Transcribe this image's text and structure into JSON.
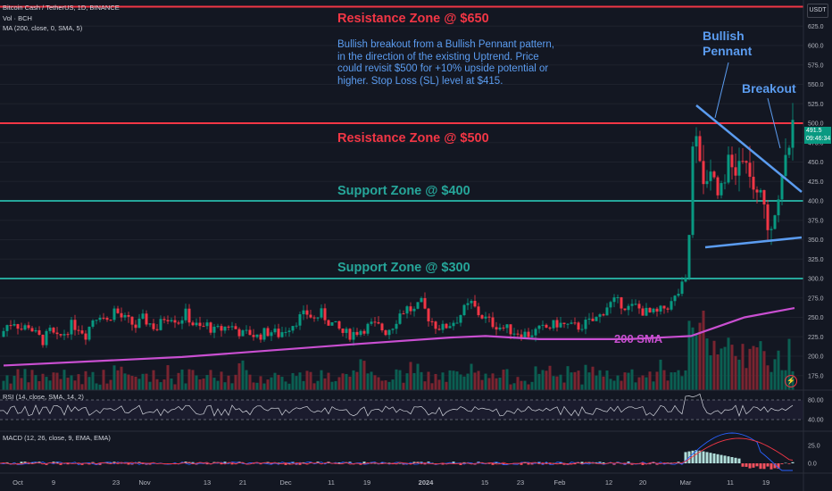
{
  "header": {
    "title": "Bitcoin Cash / TetherUS, 1D, BINANCE",
    "vol": "Vol · BCH",
    "ma": "MA (200, close, 0, SMA, 5)",
    "rsi": "RSI (14, close, SMA, 14, 2)",
    "macd": "MACD (12, 26, close, 9, EMA, EMA)"
  },
  "currency_button": "USDT",
  "last_price": {
    "value": "491.5",
    "countdown": "09:46:34"
  },
  "note": "Bullish breakout from a Bullish Pennant pattern, in the direction of the existing Uptrend. Price could revisit $500 for +10% upside potential or higher. Stop Loss (SL) level at $415.",
  "zones": [
    {
      "label": "Resistance Zone @ $650",
      "price": 650,
      "color": "#f23645"
    },
    {
      "label": "Resistance Zone @ $500",
      "price": 500,
      "color": "#f23645"
    },
    {
      "label": "Support Zone @ $400",
      "price": 400,
      "color": "#26a69a"
    },
    {
      "label": "Support Zone @ $300",
      "price": 300,
      "color": "#26a69a"
    }
  ],
  "annotations": {
    "pennant": "Bullish Pennant",
    "breakout": "Breakout",
    "sma": "200 SMA"
  },
  "colors": {
    "up": "#089981",
    "down": "#f23645",
    "sma": "#c94fd1",
    "pattern": "#5b9cf0",
    "bg": "#131722"
  },
  "chart_data": {
    "type": "candlestick",
    "title": "Bitcoin Cash / TetherUS, 1D, BINANCE",
    "price_axis": {
      "ylim": [
        164,
        664
      ],
      "ticks": [
        625,
        600,
        575,
        550,
        525,
        500,
        475,
        450,
        425,
        400,
        375,
        350,
        325,
        300,
        275,
        250,
        225,
        200,
        175
      ]
    },
    "x_ticks": [
      "Oct",
      "9",
      "23",
      "Nov",
      "13",
      "21",
      "Dec",
      "11",
      "19",
      "2024",
      "15",
      "23",
      "Feb",
      "12",
      "20",
      "Mar",
      "11",
      "19"
    ],
    "close_path": [
      [
        0,
        225
      ],
      [
        8,
        240
      ],
      [
        16,
        245
      ],
      [
        24,
        235
      ],
      [
        32,
        240
      ],
      [
        40,
        228
      ],
      [
        48,
        220
      ],
      [
        56,
        232
      ],
      [
        64,
        222
      ],
      [
        72,
        230
      ],
      [
        80,
        240
      ],
      [
        88,
        238
      ],
      [
        96,
        228
      ],
      [
        104,
        248
      ],
      [
        112,
        255
      ],
      [
        120,
        245
      ],
      [
        128,
        260
      ],
      [
        136,
        250
      ],
      [
        144,
        245
      ],
      [
        152,
        238
      ],
      [
        160,
        248
      ],
      [
        168,
        242
      ],
      [
        176,
        235
      ],
      [
        184,
        250
      ],
      [
        192,
        252
      ],
      [
        200,
        245
      ],
      [
        208,
        255
      ],
      [
        216,
        242
      ],
      [
        224,
        236
      ],
      [
        232,
        240
      ],
      [
        240,
        232
      ],
      [
        248,
        235
      ],
      [
        256,
        240
      ],
      [
        264,
        235
      ],
      [
        272,
        228
      ],
      [
        280,
        230
      ],
      [
        288,
        225
      ],
      [
        296,
        230
      ],
      [
        304,
        232
      ],
      [
        312,
        228
      ],
      [
        320,
        235
      ],
      [
        328,
        242
      ],
      [
        336,
        250
      ],
      [
        344,
        255
      ],
      [
        352,
        248
      ],
      [
        360,
        255
      ],
      [
        368,
        245
      ],
      [
        376,
        238
      ],
      [
        384,
        230
      ],
      [
        392,
        228
      ],
      [
        400,
        232
      ],
      [
        408,
        236
      ],
      [
        416,
        240
      ],
      [
        424,
        238
      ],
      [
        432,
        232
      ],
      [
        440,
        240
      ],
      [
        448,
        255
      ],
      [
        456,
        262
      ],
      [
        464,
        258
      ],
      [
        472,
        268
      ],
      [
        480,
        250
      ],
      [
        488,
        240
      ],
      [
        496,
        236
      ],
      [
        504,
        242
      ],
      [
        512,
        248
      ],
      [
        520,
        260
      ],
      [
        528,
        268
      ],
      [
        536,
        255
      ],
      [
        544,
        248
      ],
      [
        552,
        242
      ],
      [
        560,
        238
      ],
      [
        568,
        235
      ],
      [
        576,
        232
      ],
      [
        584,
        230
      ],
      [
        592,
        228
      ],
      [
        600,
        232
      ],
      [
        608,
        235
      ],
      [
        616,
        238
      ],
      [
        624,
        242
      ],
      [
        632,
        240
      ],
      [
        640,
        238
      ],
      [
        648,
        238
      ],
      [
        656,
        242
      ],
      [
        664,
        245
      ],
      [
        672,
        252
      ],
      [
        680,
        265
      ],
      [
        688,
        270
      ],
      [
        696,
        268
      ],
      [
        704,
        262
      ],
      [
        712,
        264
      ],
      [
        720,
        258
      ],
      [
        728,
        255
      ],
      [
        736,
        255
      ],
      [
        744,
        262
      ],
      [
        752,
        268
      ],
      [
        758,
        278
      ],
      [
        764,
        290
      ],
      [
        770,
        300
      ],
      [
        776,
        470
      ],
      [
        779,
        500
      ],
      [
        782,
        480
      ],
      [
        786,
        440
      ],
      [
        790,
        420
      ],
      [
        794,
        445
      ],
      [
        798,
        440
      ],
      [
        802,
        420
      ],
      [
        806,
        415
      ],
      [
        810,
        430
      ],
      [
        814,
        445
      ],
      [
        818,
        450
      ],
      [
        822,
        430
      ],
      [
        826,
        440
      ],
      [
        830,
        455
      ],
      [
        834,
        440
      ],
      [
        838,
        445
      ],
      [
        842,
        430
      ],
      [
        846,
        395
      ],
      [
        850,
        400
      ],
      [
        854,
        410
      ],
      [
        858,
        385
      ],
      [
        862,
        360
      ],
      [
        866,
        380
      ],
      [
        870,
        400
      ],
      [
        874,
        420
      ],
      [
        878,
        435
      ],
      [
        882,
        462
      ],
      [
        886,
        491.5
      ]
    ],
    "sma200": {
      "name": "200 SMA",
      "points": [
        [
          0,
          188
        ],
        [
          200,
          199
        ],
        [
          400,
          216
        ],
        [
          500,
          224
        ],
        [
          540,
          226
        ],
        [
          600,
          222
        ],
        [
          700,
          222
        ],
        [
          770,
          226
        ],
        [
          800,
          238
        ],
        [
          830,
          250
        ],
        [
          886,
          262
        ]
      ]
    },
    "volume": "histogram, unlabeled",
    "rsi": {
      "ticks": [
        "80.00",
        "40.00"
      ]
    },
    "macd": {
      "ticks": [
        "25.0",
        "0.0"
      ]
    }
  }
}
